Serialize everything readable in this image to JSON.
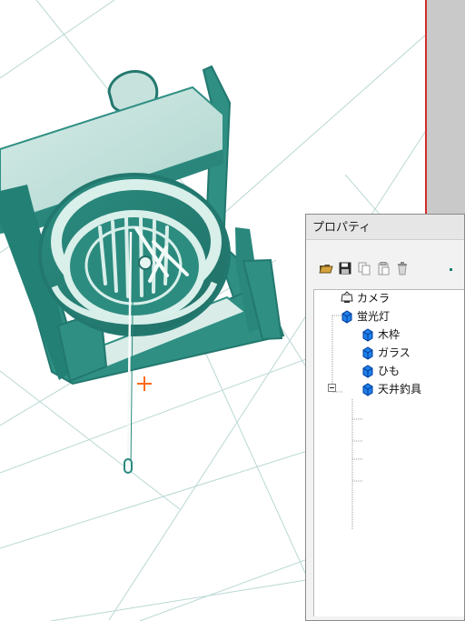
{
  "panel": {
    "title": "プロパティ"
  },
  "toolbar": {
    "buttons": [
      {
        "name": "open",
        "icon": "folder-open-icon"
      },
      {
        "name": "save",
        "icon": "save-icon"
      },
      {
        "name": "copy",
        "icon": "copy-icon"
      },
      {
        "name": "paste",
        "icon": "paste-icon"
      },
      {
        "name": "delete",
        "icon": "trash-icon"
      }
    ]
  },
  "tree": {
    "items": [
      {
        "label": "カメラ",
        "icon": "camera-icon"
      },
      {
        "label": "蛍光灯",
        "icon": "cube-icon"
      },
      {
        "label": "木枠",
        "icon": "cube-icon"
      },
      {
        "label": "ガラス",
        "icon": "cube-icon"
      },
      {
        "label": "ひも",
        "icon": "cube-icon"
      },
      {
        "label": "天井釣具",
        "icon": "cube-icon"
      }
    ]
  },
  "colors": {
    "model_fill": "#2f8f83",
    "model_light": "#d8ece8",
    "grid": "#b9d8d4",
    "cursor": "#ff6a1a",
    "selection_bar": "#d42b2b",
    "cube": "#1f7fe8"
  }
}
